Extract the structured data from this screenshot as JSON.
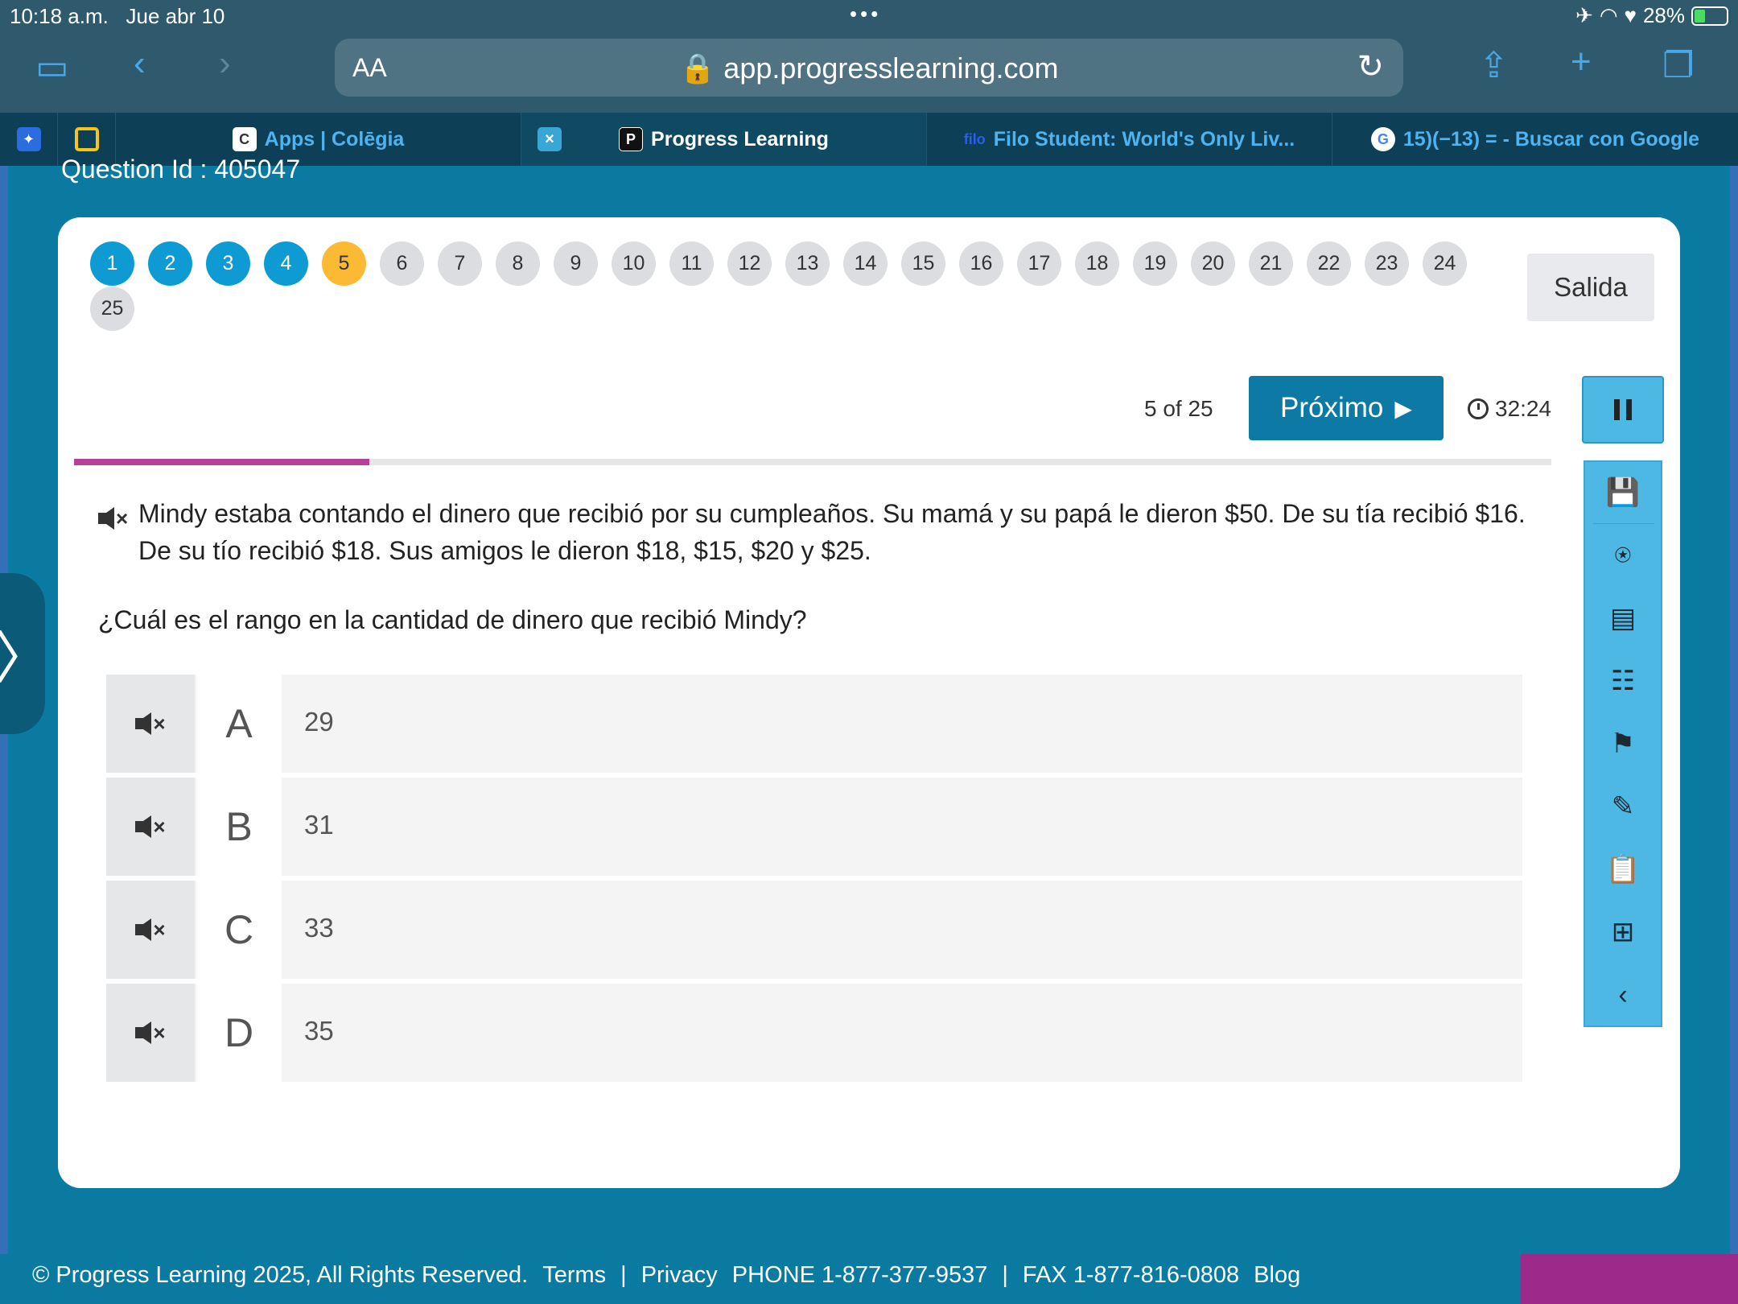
{
  "status_bar": {
    "time": "10:18 a.m.",
    "date": "Jue abr 10",
    "battery": "28%",
    "battery_level": 0.28
  },
  "browser": {
    "aa_label": "AA",
    "url": "app.progresslearning.com",
    "tabs": [
      {
        "label": "Apps | Colēgia",
        "active": false
      },
      {
        "label": "Progress Learning",
        "active": true
      },
      {
        "label": "Filo Student: World's Only Liv...",
        "active": false
      },
      {
        "label": "15)(−13) = - Buscar con Google",
        "active": false
      }
    ]
  },
  "page": {
    "question_id": "Question Id : 405047",
    "question_numbers": [
      "1",
      "2",
      "3",
      "4",
      "5",
      "6",
      "7",
      "8",
      "9",
      "10",
      "11",
      "12",
      "13",
      "14",
      "15",
      "16",
      "17",
      "18",
      "19",
      "20",
      "21",
      "22",
      "23",
      "24",
      "25"
    ],
    "answered_count": 4,
    "current_question": 5,
    "exit_label": "Salida",
    "counter": "5 of 25",
    "next_label": "Próximo",
    "timer": "32:24",
    "progress_fraction": 0.2,
    "question_text": "Mindy estaba contando el dinero que recibió por su cumpleaños. Su mamá y su papá le dieron $50. De su tía recibió $16. De su tío recibió $18. Sus amigos le dieron $18, $15, $20 y $25.",
    "prompt": "¿Cuál es el rango en la cantidad de dinero que recibió Mindy?",
    "choices": [
      {
        "letter": "A",
        "value": "29"
      },
      {
        "letter": "B",
        "value": "31"
      },
      {
        "letter": "C",
        "value": "33"
      },
      {
        "letter": "D",
        "value": "35"
      }
    ],
    "tools": [
      "save-icon",
      "accessibility-icon",
      "eraser-icon",
      "checklist-icon",
      "flag-icon",
      "highlighter-icon",
      "notepad-icon",
      "add-note-icon",
      "collapse-icon"
    ]
  },
  "footer": {
    "copyright": "© Progress Learning 2025, All Rights Reserved.",
    "terms": "Terms",
    "sep1": "|",
    "privacy": "Privacy",
    "phone": "PHONE 1-877-377-9537",
    "sep2": "|",
    "fax": "FAX 1-877-816-0808",
    "blog": "Blog"
  },
  "colors": {
    "accent": "#0c7aa4",
    "answered": "#0e9bd3",
    "current": "#fbb934",
    "progress": "#b5409a",
    "toolpanel": "#4db8e3"
  }
}
